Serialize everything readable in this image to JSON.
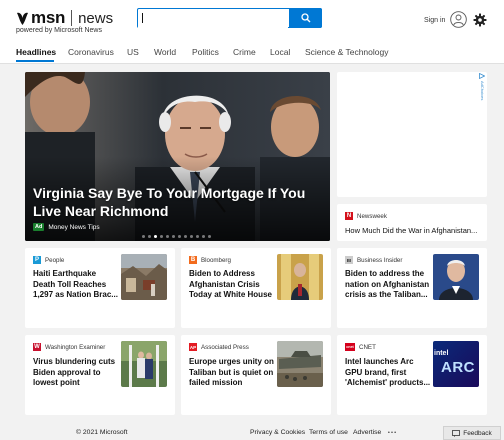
{
  "header": {
    "brand": "msn",
    "section": "news",
    "powered_by": "powered by Microsoft News",
    "search_value": "",
    "sign_in": "Sign in"
  },
  "nav": {
    "items": [
      "Headlines",
      "Coronavirus",
      "US",
      "World",
      "Politics",
      "Crime",
      "Local",
      "Science & Technology"
    ],
    "active": "Headlines"
  },
  "hero": {
    "title": "Virginia Say Bye To Your Mortgage If You Live Near Richmond",
    "ad_badge": "Ad",
    "source": "Money News Tips",
    "slide_count": 12,
    "active_slide": 3
  },
  "ad_panel": {
    "label": "AdChoices"
  },
  "cards": [
    {
      "source": "Newsweek",
      "title": "How Much Did the War in Afghanistan...",
      "logo": "N",
      "logo_color": "#d4111b"
    },
    {
      "source": "People",
      "title": "Haiti Earthquake Death Toll Reaches 1,297 as Nation Brac...",
      "logo": "P",
      "logo_color": "#1a9ad6"
    },
    {
      "source": "Bloomberg",
      "title": "Biden to Address Afghanistan Crisis Today at White House",
      "logo": "B",
      "logo_color": "#f26b1d"
    },
    {
      "source": "Business Insider",
      "title": "Biden to address the nation on Afghanistan crisis as the Taliban...",
      "logo": "BI",
      "logo_color": "#cccccc"
    },
    {
      "source": "Washington Examiner",
      "title": "Virus blundering cuts Biden approval to lowest point",
      "logo": "W",
      "logo_color": "#c8102e"
    },
    {
      "source": "Associated Press",
      "title": "Europe urges unity on Taliban but is quiet on failed mission",
      "logo": "AP",
      "logo_color": "#e31b23"
    },
    {
      "source": "CNET",
      "title": "Intel launches Arc GPU brand, first 'Alchemist' products...",
      "logo": "cnet",
      "logo_color": "#d5001c"
    }
  ],
  "thumbs": {
    "intel_text": "intel",
    "arc_text": "ARC"
  },
  "footer": {
    "copyright": "© 2021 Microsoft",
    "privacy": "Privacy & Cookies",
    "terms": "Terms of use",
    "advertise": "Advertise",
    "more": "• • •",
    "feedback": "Feedback"
  },
  "colors": {
    "accent": "#0078d4",
    "background": "#f2f2f2"
  }
}
